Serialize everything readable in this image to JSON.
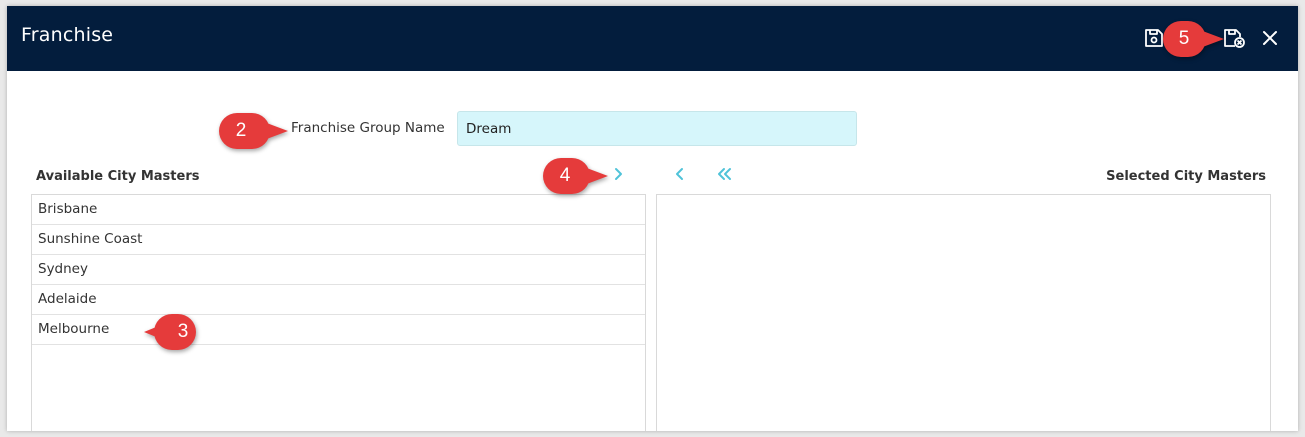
{
  "header": {
    "title": "Franchise",
    "icons": [
      "save-icon",
      "save-close-icon",
      "close-icon"
    ]
  },
  "form": {
    "group_name_label": "Franchise Group Name",
    "group_name_value": "Dream"
  },
  "available": {
    "title": "Available City Masters",
    "items": [
      "Brisbane",
      "Sunshine Coast",
      "Sydney",
      "Adelaide",
      "Melbourne"
    ]
  },
  "selected": {
    "title": "Selected City Masters",
    "items": []
  },
  "transfer_icons": [
    "chevron-right-icon",
    "chevron-left-icon",
    "double-chevron-left-icon"
  ],
  "callouts": {
    "c2": "2",
    "c3": "3",
    "c4": "4",
    "c5": "5"
  },
  "colors": {
    "header_bg": "#031d3d",
    "accent": "#4fc3d9",
    "input_bg": "#d6f6fb",
    "callout": "#e53b3b"
  }
}
